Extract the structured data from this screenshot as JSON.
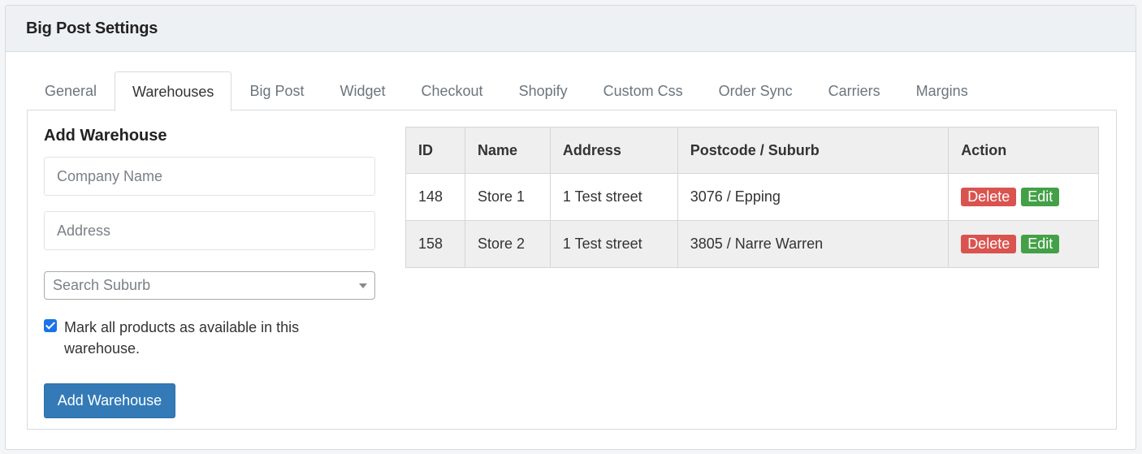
{
  "header": {
    "title": "Big Post Settings"
  },
  "tabs": [
    {
      "label": "General"
    },
    {
      "label": "Warehouses",
      "active": true
    },
    {
      "label": "Big Post"
    },
    {
      "label": "Widget"
    },
    {
      "label": "Checkout"
    },
    {
      "label": "Shopify"
    },
    {
      "label": "Custom Css"
    },
    {
      "label": "Order Sync"
    },
    {
      "label": "Carriers"
    },
    {
      "label": "Margins"
    }
  ],
  "form": {
    "title": "Add Warehouse",
    "company_placeholder": "Company Name",
    "address_placeholder": "Address",
    "suburb_placeholder": "Search Suburb",
    "mark_all_label": "Mark all products as available in this warehouse.",
    "mark_all_checked": true,
    "submit_label": "Add Warehouse"
  },
  "table": {
    "columns": [
      "ID",
      "Name",
      "Address",
      "Postcode / Suburb",
      "Action"
    ],
    "rows": [
      {
        "id": "148",
        "name": "Store 1",
        "address": "1 Test street",
        "postcode_suburb": "3076 / Epping"
      },
      {
        "id": "158",
        "name": "Store 2",
        "address": "1 Test street",
        "postcode_suburb": "3805 / Narre Warren"
      }
    ],
    "delete_label": "Delete",
    "edit_label": "Edit"
  },
  "colors": {
    "primary": "#337ab7",
    "danger": "#d9534f",
    "success": "#43a047"
  }
}
